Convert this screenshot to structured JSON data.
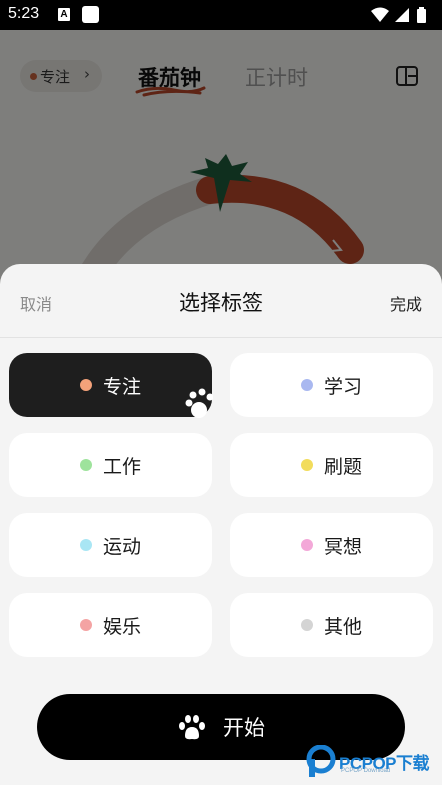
{
  "status_bar": {
    "time": "5:23",
    "notification_letter": "A"
  },
  "header": {
    "tag_pill_label": "专注",
    "tabs": [
      {
        "label": "番茄钟",
        "active": true
      },
      {
        "label": "正计时",
        "active": false
      }
    ]
  },
  "sheet": {
    "cancel_label": "取消",
    "title": "选择标签",
    "done_label": "完成",
    "options": [
      {
        "label": "专注",
        "color": "#f4a27a",
        "selected": true
      },
      {
        "label": "学习",
        "color": "#a9b8f0",
        "selected": false
      },
      {
        "label": "工作",
        "color": "#9ee39c",
        "selected": false
      },
      {
        "label": "刷题",
        "color": "#f2dc5c",
        "selected": false
      },
      {
        "label": "运动",
        "color": "#a9e6f4",
        "selected": false
      },
      {
        "label": "冥想",
        "color": "#f3a8d8",
        "selected": false
      },
      {
        "label": "娱乐",
        "color": "#f4a3a3",
        "selected": false
      },
      {
        "label": "其他",
        "color": "#d4d4d4",
        "selected": false
      }
    ],
    "start_label": "开始"
  },
  "watermark": {
    "text": "PCPOP下载",
    "sub": "PCPOP Download"
  }
}
